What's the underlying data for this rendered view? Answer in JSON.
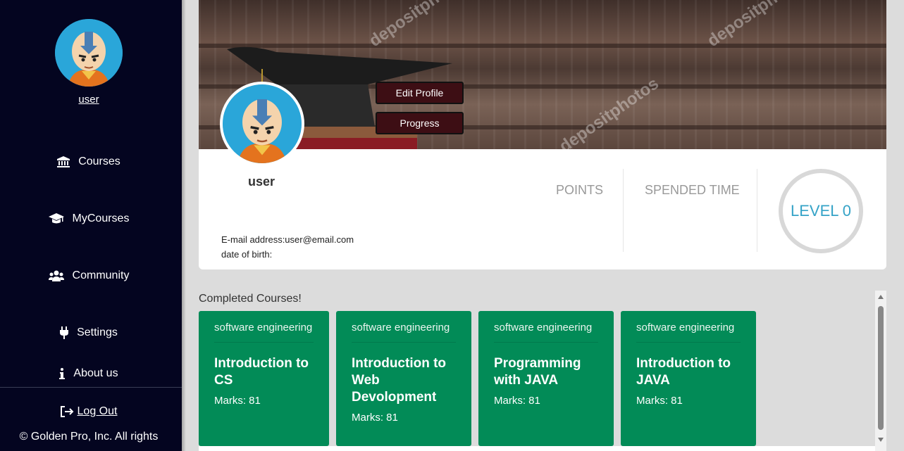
{
  "sidebar": {
    "username": "user",
    "nav": [
      {
        "label": "Courses",
        "icon": "bank-icon"
      },
      {
        "label": "MyCourses",
        "icon": "graduation-cap-icon"
      },
      {
        "label": "Community",
        "icon": "users-icon"
      },
      {
        "label": "Settings",
        "icon": "plug-icon"
      },
      {
        "label": "About us",
        "icon": "info-icon"
      }
    ],
    "logout": "Log Out",
    "copyright": "© Golden Pro, Inc. All rights"
  },
  "banner": {
    "watermark": "depositphotos"
  },
  "profile": {
    "edit_button": "Edit Profile",
    "progress_button": "Progress",
    "name": "user",
    "points_label": "POINTS",
    "time_label": "SPENDED TIME",
    "level": "LEVEL 0",
    "email_line": "E-mail address:user@email.com",
    "dob_line": "date of birth:"
  },
  "completed": {
    "title": "Completed Courses!",
    "courses": [
      {
        "category": "software engineering",
        "title": "Introduction to CS",
        "marks": "Marks: 81"
      },
      {
        "category": "software engineering",
        "title": "Introduction to Web Devolopment",
        "marks": "Marks: 81"
      },
      {
        "category": "software engineering",
        "title": "Programming with JAVA",
        "marks": "Marks: 81"
      },
      {
        "category": "software engineering",
        "title": "Introduction to JAVA",
        "marks": "Marks: 81"
      }
    ]
  },
  "colors": {
    "sidebar_bg": "#040520",
    "course_card": "#028b57",
    "button_bg": "#3d0e14",
    "level_text": "#35a3c7"
  }
}
